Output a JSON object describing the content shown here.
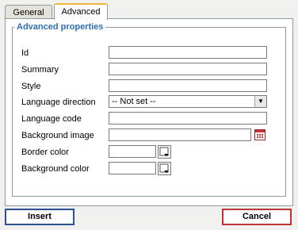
{
  "tabs": [
    {
      "label": "General",
      "active": false
    },
    {
      "label": "Advanced",
      "active": true
    }
  ],
  "fieldset": {
    "legend": "Advanced properties"
  },
  "fields": {
    "id": {
      "label": "Id",
      "value": ""
    },
    "summary": {
      "label": "Summary",
      "value": ""
    },
    "style": {
      "label": "Style",
      "value": ""
    },
    "language_direction": {
      "label": "Language direction",
      "value": "-- Not set --"
    },
    "language_code": {
      "label": "Language code",
      "value": ""
    },
    "background_image": {
      "label": "Background image",
      "value": ""
    },
    "border_color": {
      "label": "Border color",
      "value": ""
    },
    "background_color": {
      "label": "Background color",
      "value": ""
    }
  },
  "buttons": {
    "insert": "Insert",
    "cancel": "Cancel"
  },
  "colors": {
    "legend": "#2b6fb5",
    "tab_accent": "#f3b43a",
    "insert_border": "#2b4f8f",
    "cancel_border": "#b33333"
  },
  "icons": {
    "browse": "browse-icon",
    "color_picker": "color-picker-icon"
  }
}
